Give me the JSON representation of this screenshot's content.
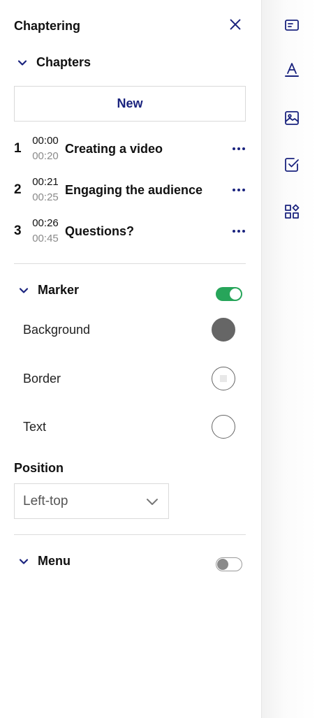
{
  "panel": {
    "title": "Chaptering",
    "chapters_section": {
      "label": "Chapters",
      "new_button": "New",
      "items": [
        {
          "number": "1",
          "start": "00:00",
          "end": "00:20",
          "title": "Creating a video"
        },
        {
          "number": "2",
          "start": "00:21",
          "end": "00:25",
          "title": "Engaging the audience"
        },
        {
          "number": "3",
          "start": "00:26",
          "end": "00:45",
          "title": "Questions?"
        }
      ]
    },
    "marker_section": {
      "label": "Marker",
      "enabled": true,
      "options": [
        {
          "label": "Background",
          "color": "#666666"
        },
        {
          "label": "Border",
          "color": "#ffffff"
        },
        {
          "label": "Text",
          "color": "#ffffff"
        }
      ],
      "position_label": "Position",
      "position_value": "Left-top"
    },
    "menu_section": {
      "label": "Menu",
      "enabled": false
    }
  },
  "rail": {
    "icons": [
      "caption-icon",
      "text-format-icon",
      "image-icon",
      "checkbox-icon",
      "widgets-icon"
    ]
  },
  "colors": {
    "accent": "#1a237e",
    "toggle_on": "#27a55a"
  }
}
